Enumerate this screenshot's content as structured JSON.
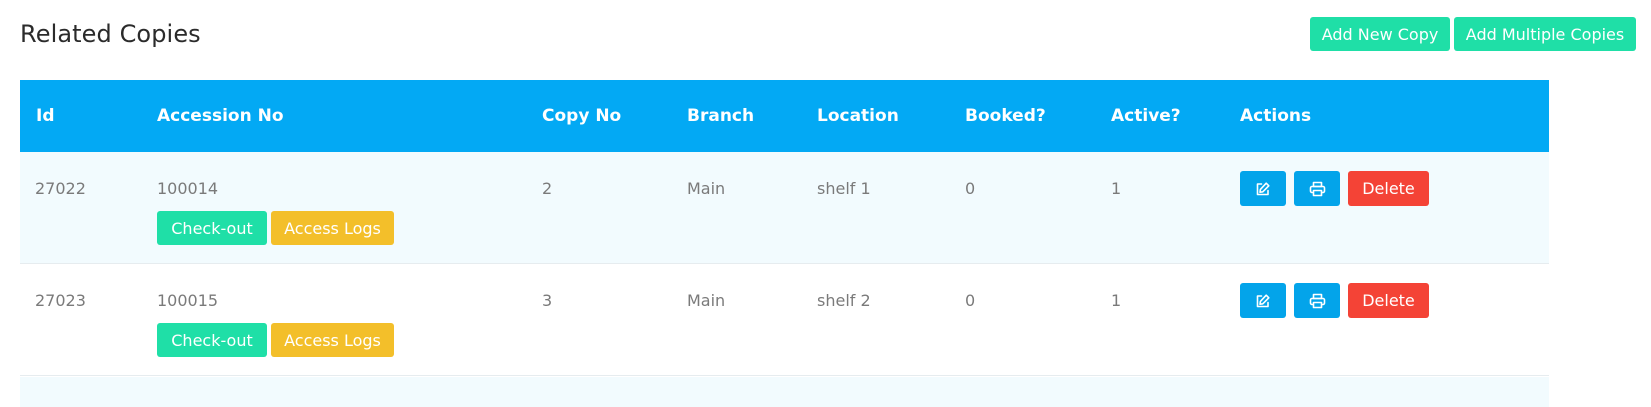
{
  "page": {
    "title": "Related Copies",
    "buttons": {
      "add_new_copy": "Add New Copy",
      "add_multiple_copies": "Add Multiple Copies"
    }
  },
  "table": {
    "headers": [
      "Id",
      "Accession No",
      "Copy No",
      "Branch",
      "Location",
      "Booked?",
      "Active?",
      "Actions"
    ],
    "rows": [
      {
        "id": "27022",
        "accession_no": "100014",
        "copy_no": "2",
        "branch": "Main",
        "location": "shelf 1",
        "booked": "0",
        "active": "1",
        "checkout_label": "Check-out",
        "access_logs_label": "Access Logs",
        "edit_icon": "edit-icon",
        "print_icon": "print-icon",
        "delete_label": "Delete"
      },
      {
        "id": "27023",
        "accession_no": "100015",
        "copy_no": "3",
        "branch": "Main",
        "location": "shelf 2",
        "booked": "0",
        "active": "1",
        "checkout_label": "Check-out",
        "access_logs_label": "Access Logs",
        "edit_icon": "edit-icon",
        "print_icon": "print-icon",
        "delete_label": "Delete"
      }
    ]
  },
  "colors": {
    "header_bg": "#03a9f4",
    "teal_button": "#1fdfa7",
    "amber_button": "#f3bf2a",
    "blue_button": "#03a4ea",
    "red_button": "#f44336"
  }
}
